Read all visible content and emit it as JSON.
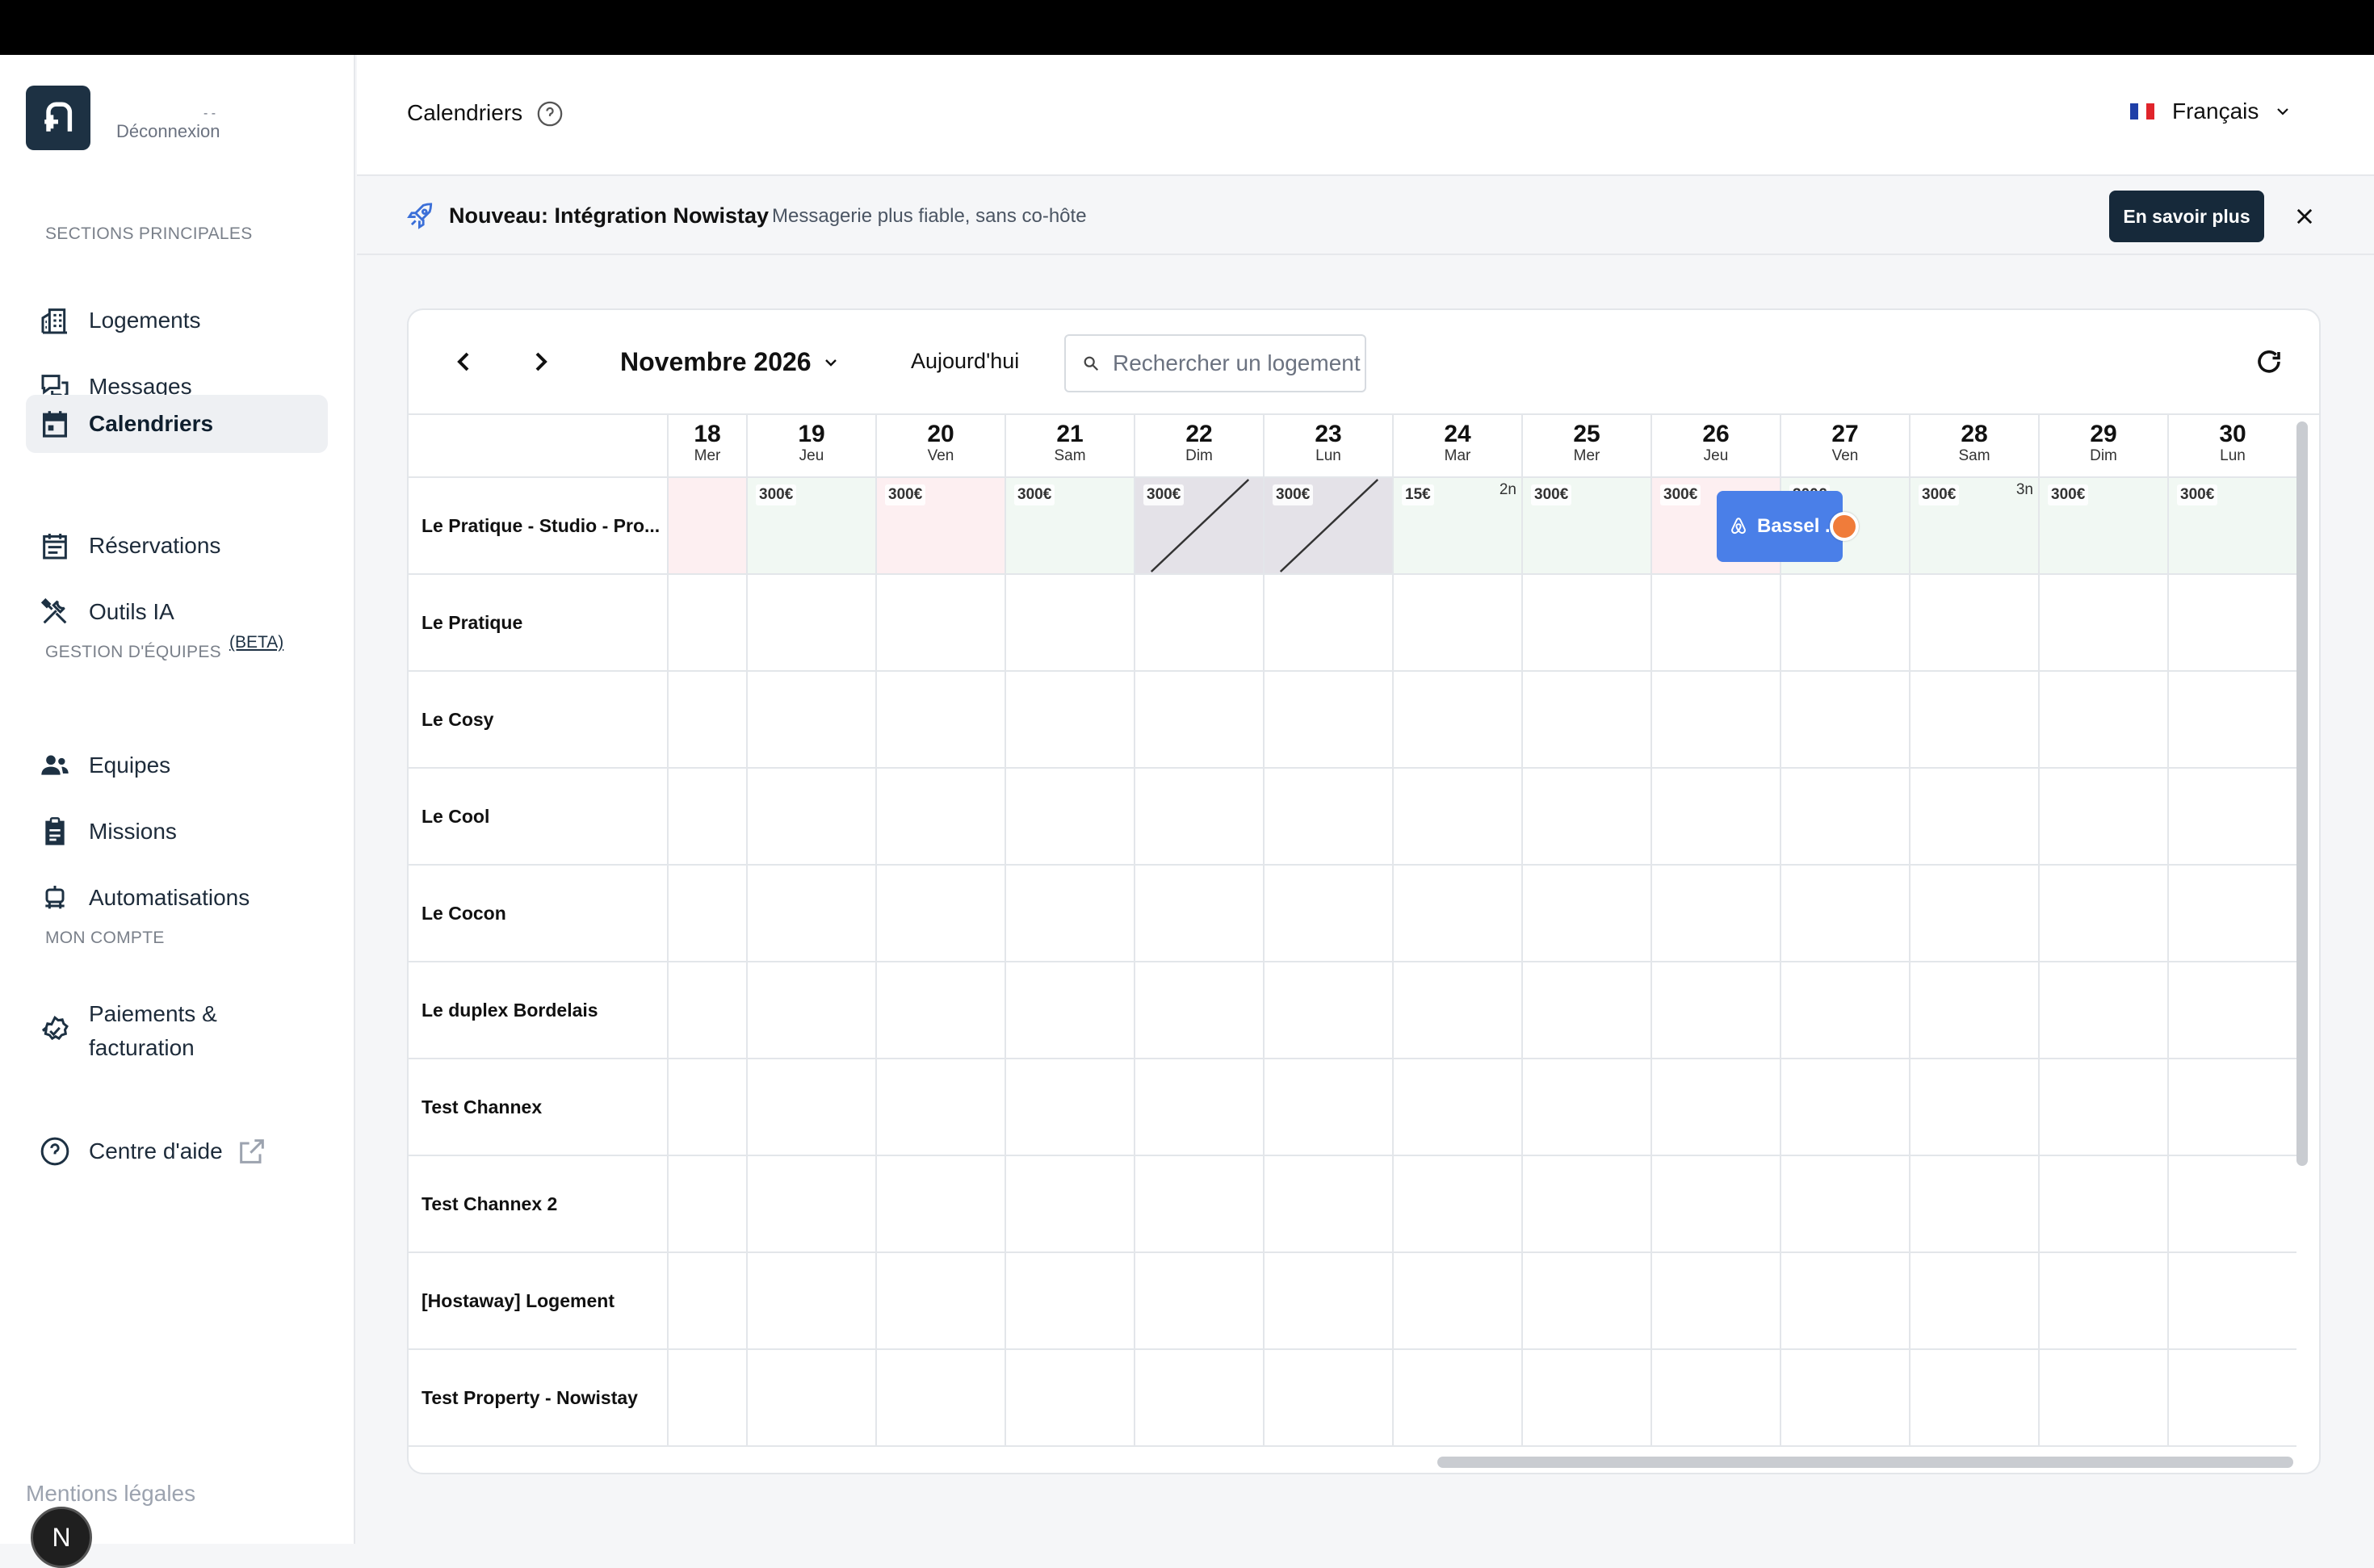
{
  "sidebar": {
    "logout": "Déconnexion",
    "logout_dash": "- -",
    "sections": {
      "main": "SECTIONS PRINCIPALES",
      "teams": "GESTION D'ÉQUIPES",
      "teams_beta": "(BETA)",
      "account": "MON COMPTE"
    },
    "main_items": [
      {
        "label": "Logements",
        "icon": "building-icon"
      },
      {
        "label": "Messages",
        "icon": "chat-icon"
      },
      {
        "label": "Calendriers",
        "icon": "calendar-icon",
        "active": true
      },
      {
        "label": "Réservations",
        "icon": "reservations-icon"
      },
      {
        "label": "Outils IA",
        "icon": "tools-icon"
      }
    ],
    "team_items": [
      {
        "label": "Equipes",
        "icon": "team-icon"
      },
      {
        "label": "Missions",
        "icon": "clipboard-icon"
      },
      {
        "label": "Automatisations",
        "icon": "robot-icon"
      }
    ],
    "account_items": [
      {
        "label_line1": "Paiements &",
        "label_line2": "facturation",
        "icon": "payment-badge-icon"
      },
      {
        "label": "Centre d'aide",
        "icon": "help-circle-icon"
      }
    ],
    "legal": "Mentions légales",
    "badge_letter": "N"
  },
  "header": {
    "title": "Calendriers",
    "language": "Français"
  },
  "banner": {
    "title": "Nouveau: Intégration Nowistay",
    "subtitle": "Messagerie plus fiable, sans co-hôte",
    "button": "En savoir plus"
  },
  "calendar": {
    "month": "Novembre 2026",
    "today": "Aujourd'hui",
    "search_placeholder": "Rechercher un logement",
    "days": [
      {
        "num": "18",
        "dow": "Mer"
      },
      {
        "num": "19",
        "dow": "Jeu"
      },
      {
        "num": "20",
        "dow": "Ven"
      },
      {
        "num": "21",
        "dow": "Sam"
      },
      {
        "num": "22",
        "dow": "Dim"
      },
      {
        "num": "23",
        "dow": "Lun"
      },
      {
        "num": "24",
        "dow": "Mar"
      },
      {
        "num": "25",
        "dow": "Mer"
      },
      {
        "num": "26",
        "dow": "Jeu"
      },
      {
        "num": "27",
        "dow": "Ven"
      },
      {
        "num": "28",
        "dow": "Sam"
      },
      {
        "num": "29",
        "dow": "Dim"
      },
      {
        "num": "30",
        "dow": "Lun"
      }
    ],
    "properties": [
      "Le Pratique - Studio - Pro...",
      "Le Pratique",
      "Le Cosy",
      "Le Cool",
      "Le Cocon",
      "Le duplex Bordelais",
      "Test Channex",
      "Test Channex 2",
      "[Hostaway] Logement",
      "Test Property - Nowistay"
    ],
    "first_row_cells": [
      {
        "price": "",
        "status": "pink"
      },
      {
        "price": "300€",
        "status": "green"
      },
      {
        "price": "300€",
        "status": "pink"
      },
      {
        "price": "300€",
        "status": "green"
      },
      {
        "price": "300€",
        "status": "blocked"
      },
      {
        "price": "300€",
        "status": "blocked"
      },
      {
        "price": "15€",
        "status": "green",
        "min_nights": "2n"
      },
      {
        "price": "300€",
        "status": "green"
      },
      {
        "price": "300€",
        "status": "pink"
      },
      {
        "price": "300€",
        "status": "green"
      },
      {
        "price": "300€",
        "status": "green",
        "min_nights": "3n"
      },
      {
        "price": "300€",
        "status": "green"
      },
      {
        "price": "300€",
        "status": "green"
      }
    ],
    "booking": {
      "guest": "Bassel ...",
      "source_icon": "airbnb-icon"
    },
    "colors": {
      "green": "#f1f8f3",
      "pink": "#fdeff1",
      "blocked": "#e4e2e8",
      "booking": "#4a7fe8",
      "booking_dot": "#f07c3a"
    }
  }
}
